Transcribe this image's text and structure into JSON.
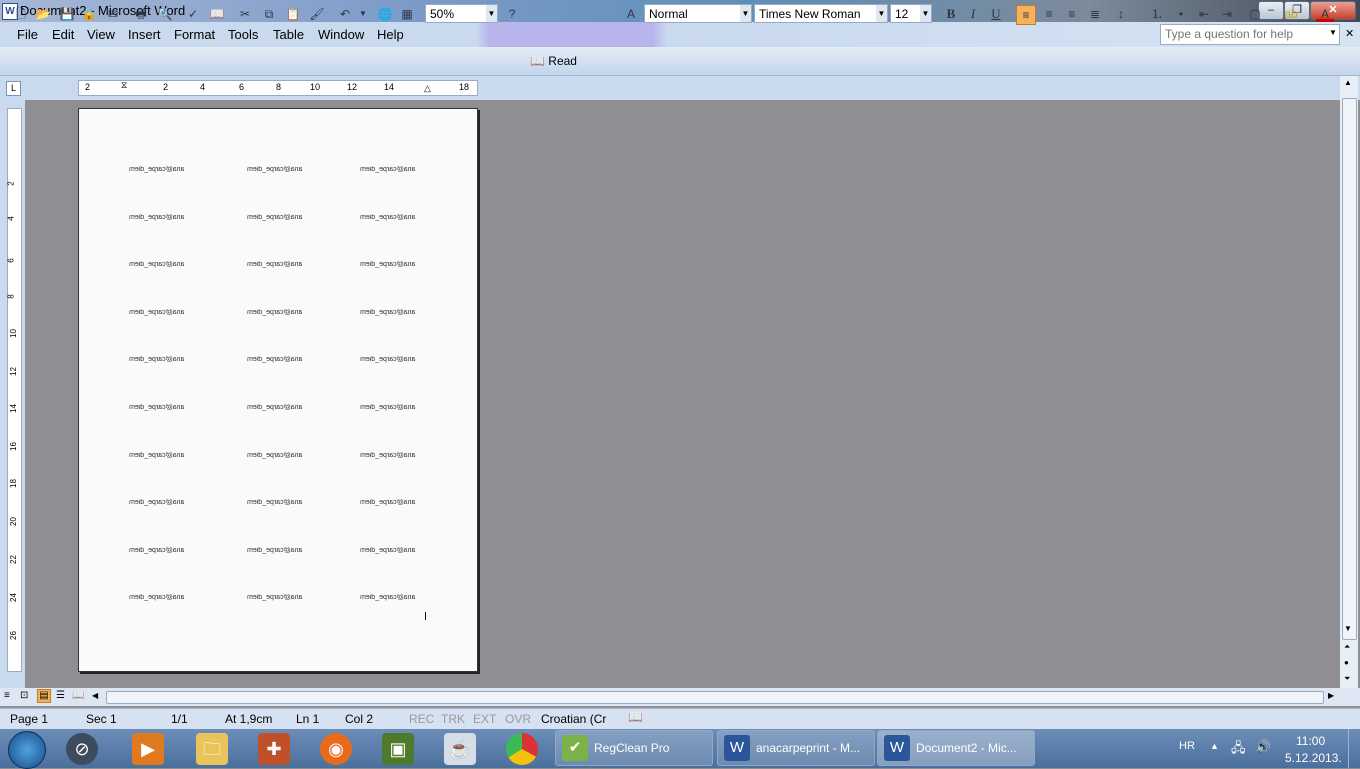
{
  "window": {
    "title": "Document2 - Microsoft Word"
  },
  "menu": {
    "items": [
      "File",
      "Edit",
      "View",
      "Insert",
      "Format",
      "Tools",
      "Table",
      "Window",
      "Help"
    ],
    "help_placeholder": "Type a question for help"
  },
  "toolbar": {
    "zoom": "50%",
    "read_label": "Read",
    "style": "Normal",
    "font": "Times New Roman",
    "size": "12"
  },
  "ruler": {
    "h_ticks": [
      "2",
      "2",
      "4",
      "6",
      "8",
      "10",
      "12",
      "14",
      "18"
    ],
    "v_ticks": [
      "2",
      "4",
      "6",
      "8",
      "10",
      "12",
      "14",
      "16",
      "18",
      "20",
      "22",
      "24",
      "26"
    ]
  },
  "document": {
    "label_text": "ana@carpe_diem",
    "rows": 10,
    "cols": 3
  },
  "status": {
    "page": "Page 1",
    "sec": "Sec 1",
    "pages": "1/1",
    "at": "At 1,9cm",
    "ln": "Ln 1",
    "col": "Col 2",
    "rec": "REC",
    "trk": "TRK",
    "ext": "EXT",
    "ovr": "OVR",
    "lang": "Croatian (Cr"
  },
  "taskbar": {
    "tasks": [
      {
        "label": "RegClean Pro"
      },
      {
        "label": "anacarpeprint - M..."
      },
      {
        "label": "Document2 - Mic..."
      }
    ],
    "lang": "HR",
    "time": "11:00",
    "date": "5.12.2013."
  },
  "colors": {
    "accent": "#4b6f9c",
    "active_align": "#f5b25a"
  }
}
